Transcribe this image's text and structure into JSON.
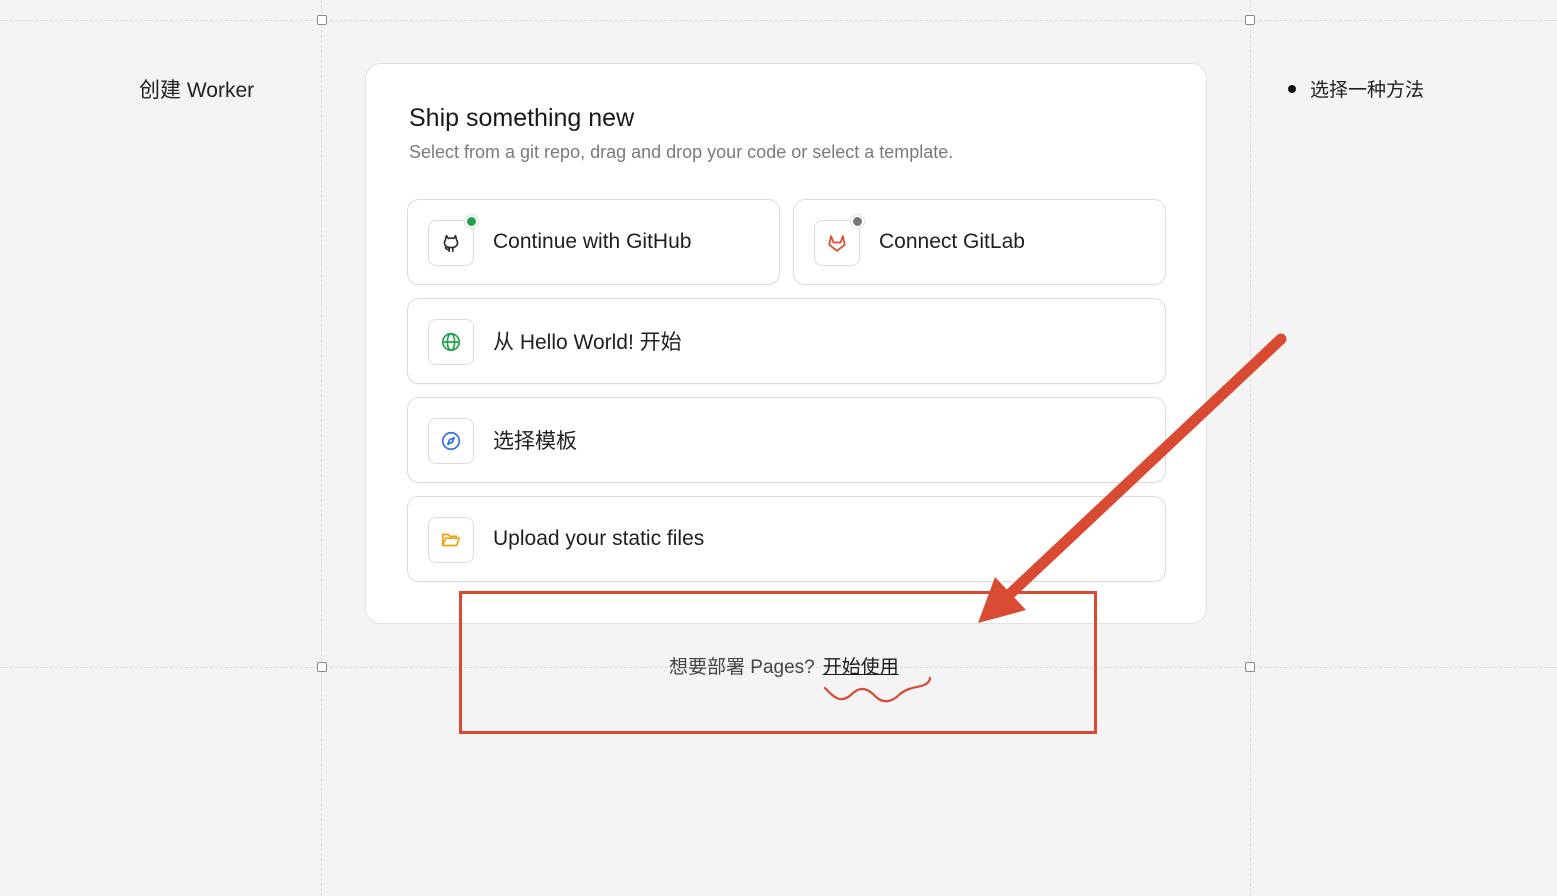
{
  "left_panel": {
    "title": "创建 Worker"
  },
  "right_panel": {
    "step_label": "选择一种方法"
  },
  "card": {
    "title": "Ship something new",
    "subtitle": "Select from a git repo, drag and drop your code or select a template.",
    "options": [
      {
        "label": "Continue with GitHub",
        "icon": "github-icon",
        "status_color": "#1fa24a"
      },
      {
        "label": "Connect GitLab",
        "icon": "gitlab-icon",
        "status_color": "#777777"
      },
      {
        "label": "从 Hello World! 开始",
        "icon": "globe-icon"
      },
      {
        "label": "选择模板",
        "icon": "compass-icon"
      },
      {
        "label": "Upload your static files",
        "icon": "folder-icon"
      }
    ]
  },
  "pages_prompt": {
    "text": "想要部署 Pages?",
    "link": "开始使用"
  },
  "colors": {
    "background": "#f4f4f4",
    "annotation": "#d94a33",
    "globe": "#1fa24a",
    "compass": "#2f6fe0",
    "folder": "#f0a20a",
    "gitlab": "#e2492f"
  }
}
